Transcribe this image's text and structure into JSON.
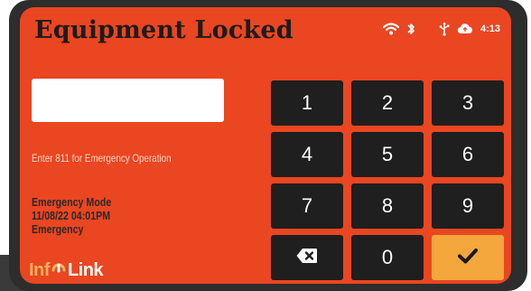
{
  "header": {
    "title": "Equipment Locked",
    "time": "4:13"
  },
  "status_icons": [
    "wifi-icon",
    "bluetooth-icon",
    "usb-icon",
    "cloud-icon"
  ],
  "pin_input": {
    "value": "",
    "placeholder": ""
  },
  "hint": "Enter 811 for Emergency Operation",
  "mode": {
    "line1": "Emergency Mode",
    "line2": "11/08/22 04:01PM",
    "line3": "Emergency"
  },
  "logo": {
    "text_pre": "Inf",
    "text_post": "Link"
  },
  "keypad": {
    "keys": [
      "1",
      "2",
      "3",
      "4",
      "5",
      "6",
      "7",
      "8",
      "9"
    ],
    "zero": "0",
    "backspace_icon": "backspace-icon",
    "enter_icon": "checkmark-icon"
  },
  "colors": {
    "screen_background": "#ea4621",
    "key_background": "#1f1f1f",
    "enter_key": "#f3a73c",
    "title_text": "#1c1c1c",
    "hint_text": "#ffd7c6"
  }
}
